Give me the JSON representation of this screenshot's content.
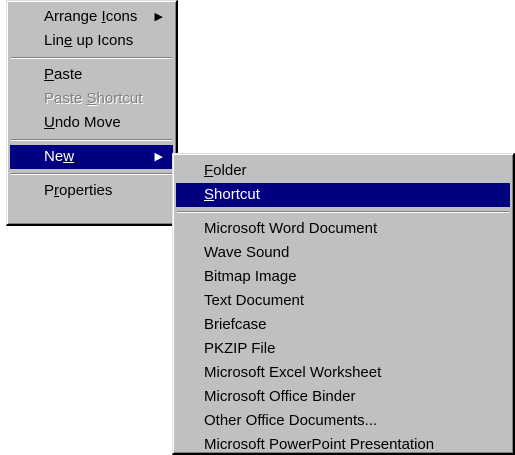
{
  "context_menu": {
    "items": [
      {
        "pre": "Arrange ",
        "ul": "I",
        "post": "cons"
      },
      {
        "pre": "Lin",
        "ul": "e",
        "post": " up Icons"
      },
      {
        "pre": "",
        "ul": "P",
        "post": "aste"
      },
      {
        "pre": "Paste ",
        "ul": "S",
        "post": "hortcut"
      },
      {
        "pre": "",
        "ul": "U",
        "post": "ndo Move"
      },
      {
        "pre": "Ne",
        "ul": "w",
        "post": ""
      },
      {
        "pre": "P",
        "ul": "r",
        "post": "operties"
      }
    ],
    "submenu_arrow_icon": "triangle-right",
    "selected_item": "New"
  },
  "new_submenu": {
    "items": [
      {
        "pre": "",
        "ul": "F",
        "post": "older"
      },
      {
        "pre": "",
        "ul": "S",
        "post": "hortcut"
      },
      {
        "label": "Microsoft Word Document"
      },
      {
        "label": "Wave Sound"
      },
      {
        "label": "Bitmap Image"
      },
      {
        "label": "Text Document"
      },
      {
        "label": "Briefcase"
      },
      {
        "label": "PKZIP File"
      },
      {
        "label": "Microsoft Excel Worksheet"
      },
      {
        "label": "Microsoft Office Binder"
      },
      {
        "label": "Other Office Documents..."
      },
      {
        "label": "Microsoft PowerPoint Presentation"
      }
    ],
    "selected_item": "Shortcut"
  },
  "colors": {
    "menu_face": "#c0c0c0",
    "highlight": "#000080",
    "highlight_text": "#ffffff",
    "disabled_text": "#808080"
  }
}
